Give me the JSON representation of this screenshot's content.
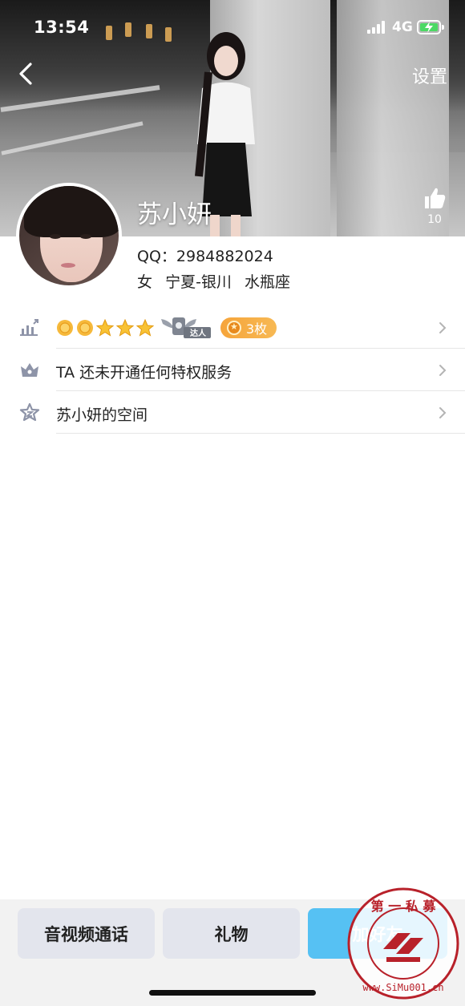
{
  "status_bar": {
    "time": "13:54",
    "network": "4G",
    "battery_color": "#4cd964"
  },
  "nav": {
    "back_icon": "chevron-left-icon",
    "settings_label": "设置"
  },
  "header": {
    "like_icon": "thumbs-up-icon",
    "like_count": "10"
  },
  "profile": {
    "name": "苏小妍",
    "qq_label": "QQ：",
    "qq_number": "2984882024",
    "gender": "女",
    "location": "宁夏-银川",
    "zodiac": "水瓶座"
  },
  "rows": {
    "level": {
      "icon": "level-chart-icon",
      "badge_text": "达人",
      "medal_count": "3枚",
      "sun_count": 2,
      "star_count": 3
    },
    "privilege": {
      "icon": "crown-icon",
      "label": "TA 还未开通任何特权服务"
    },
    "space": {
      "icon": "star-outline-icon",
      "label": "苏小妍的空间"
    }
  },
  "bottom": {
    "call_label": "音视频通话",
    "gift_label": "礼物",
    "add_label": "加好友",
    "add_color": "#56c1f3"
  },
  "watermark": {
    "top_text": "第一私募",
    "bottom_text": "www.SiMu001.cn"
  }
}
